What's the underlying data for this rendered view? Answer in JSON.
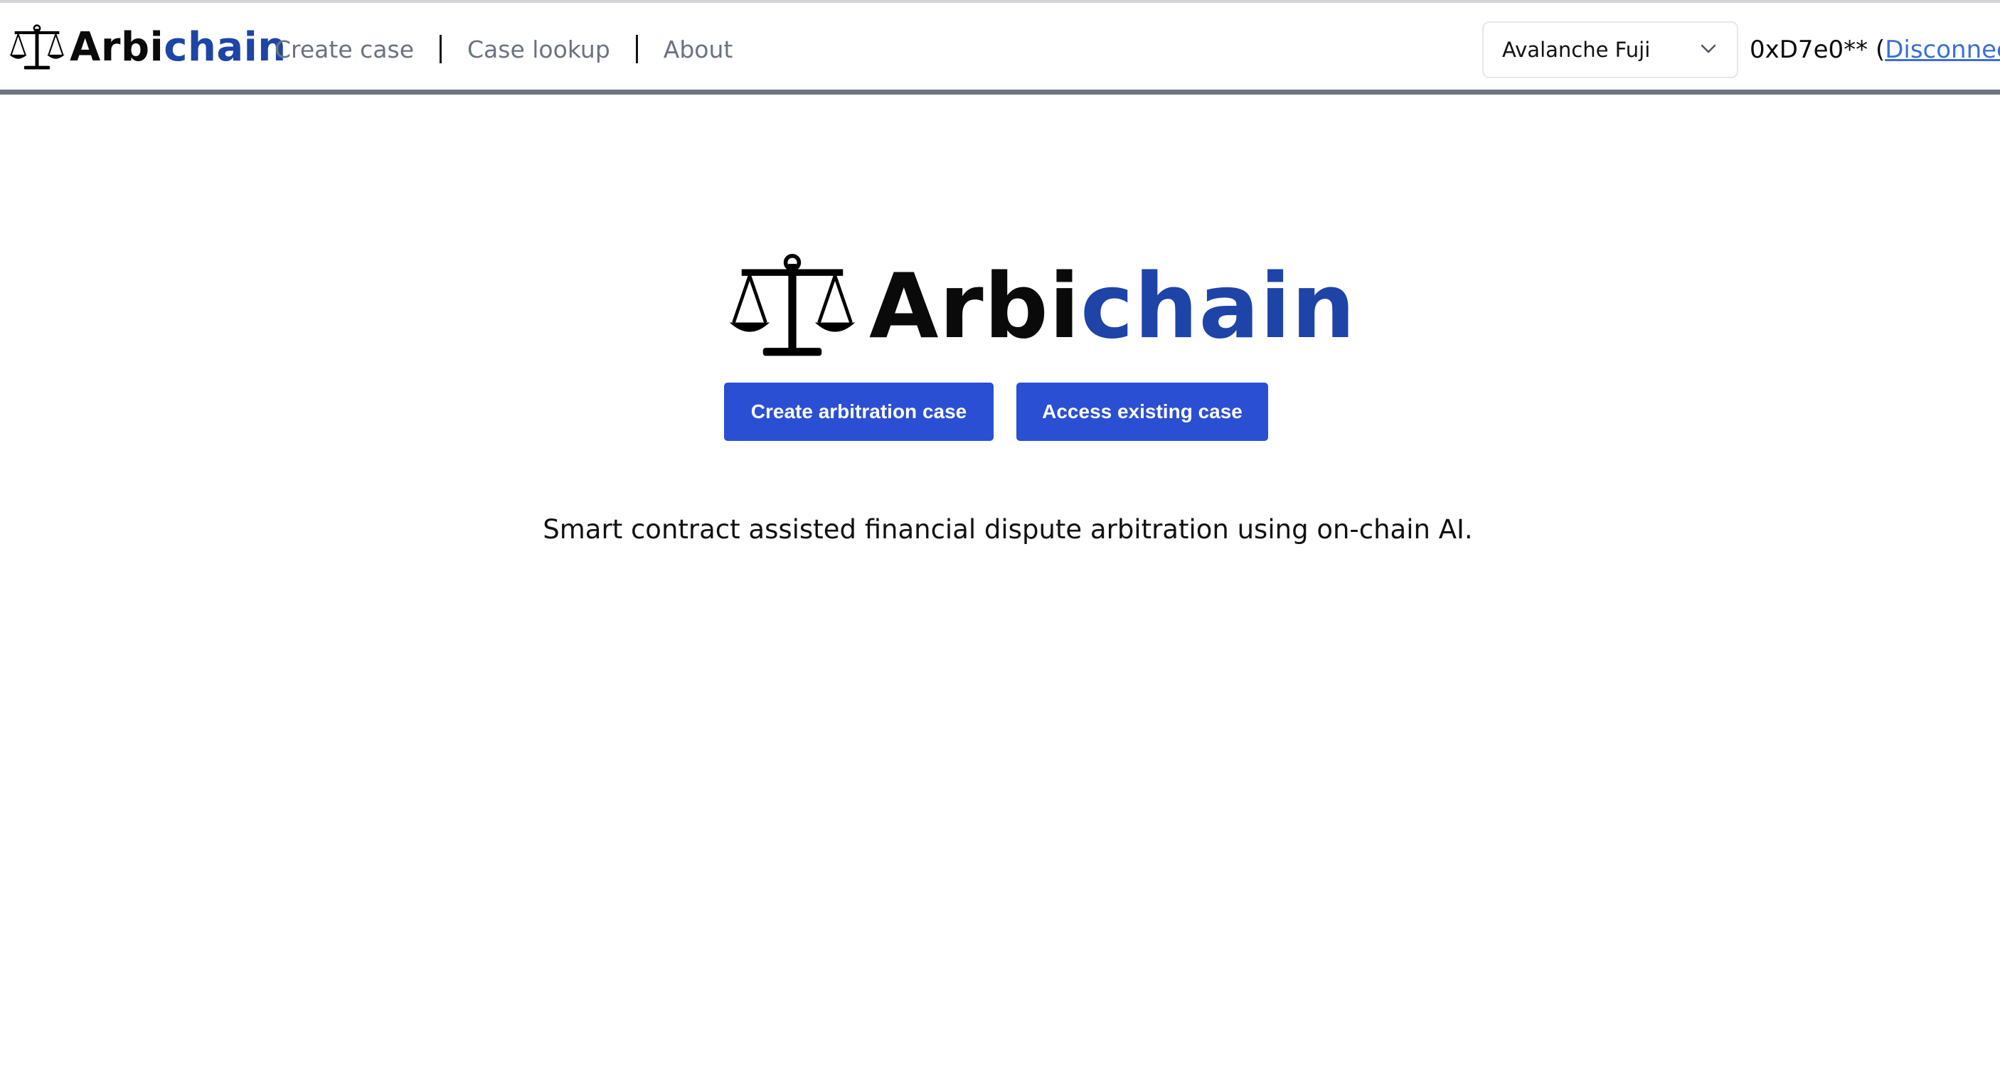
{
  "header": {
    "brand": {
      "part1": "Arbi",
      "part2": "chain"
    },
    "nav": [
      {
        "label": "Create case"
      },
      {
        "label": "Case lookup"
      },
      {
        "label": "About"
      }
    ],
    "network_select": {
      "value": "Avalanche Fuji"
    },
    "account": {
      "address": "0xD7e0**",
      "open_paren": "(",
      "disconnect_label": "Disconnect",
      "close_paren": ")"
    }
  },
  "hero": {
    "logo": {
      "part1": "Arbi",
      "part2": "chain"
    },
    "buttons": {
      "create": "Create arbitration case",
      "access": "Access existing case"
    },
    "tagline": "Smart contract assisted financial dispute arbitration using on-chain AI."
  },
  "colors": {
    "brand_dark": "#0a0a0a",
    "brand_blue": "#1e44a8",
    "button_bg": "#2b4fd3",
    "link_blue": "#3b6fd8",
    "nav_text": "#6b7280"
  }
}
